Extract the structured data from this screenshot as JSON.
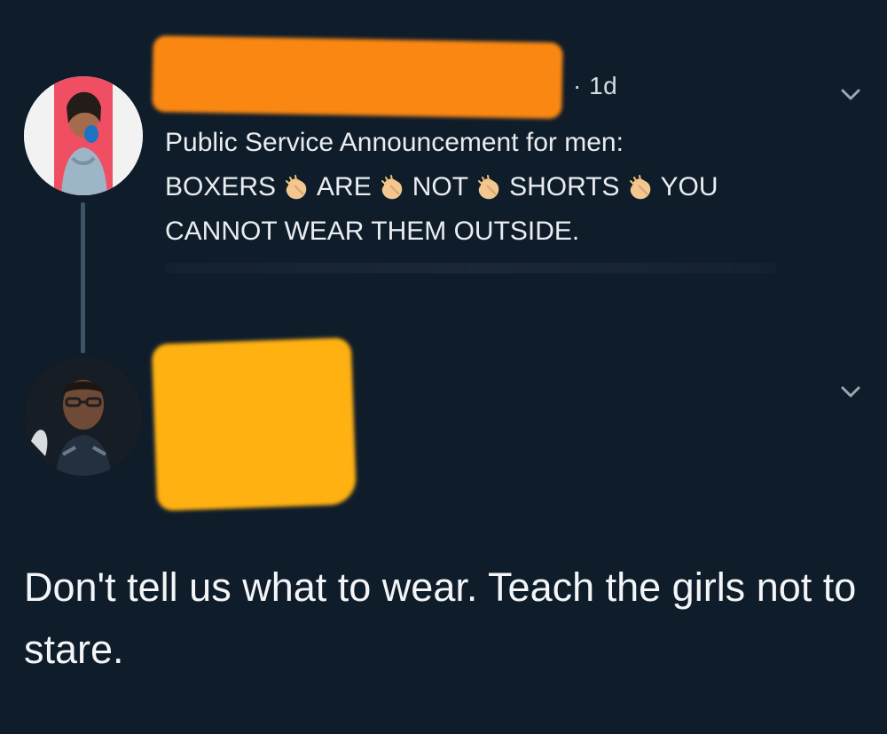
{
  "thread": {
    "post": {
      "meta": {
        "time": "· 1d"
      },
      "text": {
        "line1": "Public Service Announcement for men:",
        "line2": [
          "BOXERS",
          "ARE",
          "NOT",
          "SHORTS",
          "YOU"
        ],
        "line3": "CANNOT WEAR THEM OUTSIDE."
      },
      "icons": {
        "chevron": "chevron-down-icon",
        "clap": "clapping-hands-icon"
      }
    },
    "reply": {
      "icons": {
        "chevron": "chevron-down-icon"
      },
      "text": "Don't tell us what to wear. Teach the girls not to stare."
    }
  },
  "colors": {
    "background": "#0f1c2a",
    "text": "#e9edf0",
    "meta": "#d6dbe0",
    "thread_line": "#3d5466",
    "redaction_orange": "#ff8a12",
    "redaction_yellow": "#ffb112"
  }
}
